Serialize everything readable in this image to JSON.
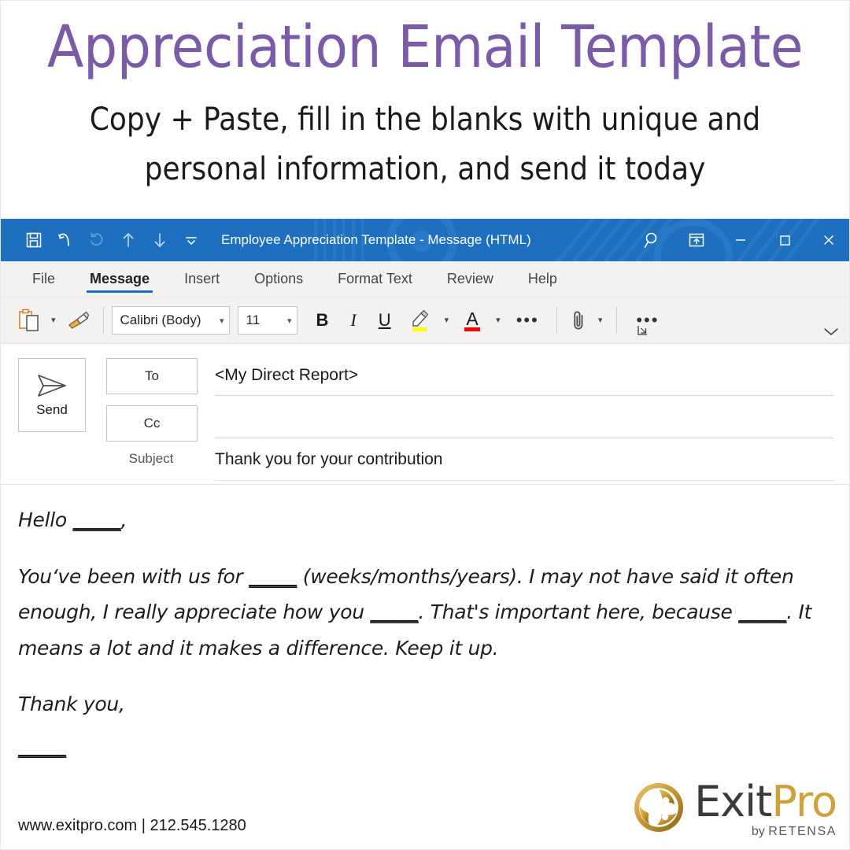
{
  "promo": {
    "title": "Appreciation Email Template",
    "subtitle": "Copy + Paste, fill in the blanks with unique and personal information, and send it today",
    "title_color": "#7B5BA8",
    "subtitle_color": "#1b1b1b"
  },
  "window": {
    "accent_color": "#1e6fc0",
    "title": "Employee Appreciation Template  -  Message (HTML)",
    "quick_access": [
      {
        "name": "save-icon",
        "label": "Save",
        "enabled": true
      },
      {
        "name": "undo-icon",
        "label": "Undo",
        "enabled": true
      },
      {
        "name": "redo-icon",
        "label": "Redo",
        "enabled": false
      },
      {
        "name": "previous-item-icon",
        "label": "Previous Item",
        "enabled": true
      },
      {
        "name": "next-item-icon",
        "label": "Next Item",
        "enabled": true
      },
      {
        "name": "customize-quick-access-icon",
        "label": "Customize Quick Access Toolbar",
        "enabled": true
      }
    ],
    "title_right": [
      {
        "name": "search-icon",
        "label": "Search"
      },
      {
        "name": "ribbon-display-options-icon",
        "label": "Ribbon Display Options"
      },
      {
        "name": "minimize-icon",
        "label": "Minimize"
      },
      {
        "name": "maximize-icon",
        "label": "Maximize"
      },
      {
        "name": "close-icon",
        "label": "Close"
      }
    ]
  },
  "ribbon": {
    "tabs": [
      {
        "label": "File",
        "active": false
      },
      {
        "label": "Message",
        "active": true
      },
      {
        "label": "Insert",
        "active": false
      },
      {
        "label": "Options",
        "active": false
      },
      {
        "label": "Format Text",
        "active": false
      },
      {
        "label": "Review",
        "active": false
      },
      {
        "label": "Help",
        "active": false
      }
    ]
  },
  "toolbar": {
    "paste_icon": "paste-icon",
    "format_painter_icon": "format-painter-icon",
    "font_name": "Calibri (Body)",
    "font_size": "11",
    "bold_label": "B",
    "italic_label": "I",
    "underline_label": "U",
    "highlight_icon": "text-highlight-color-icon",
    "highlight_color": "#ffff00",
    "font_color_label": "A",
    "font_color": "#ff0000",
    "more_formatting_label": "•••",
    "dialog_launcher_icon": "dialog-box-launcher-icon",
    "attach_icon": "attach-file-icon",
    "more_commands_label": "•••",
    "collapse_ribbon_icon": "collapse-ribbon-icon"
  },
  "compose": {
    "send_label": "Send",
    "send_icon": "send-paper-plane-icon",
    "to_label": "To",
    "cc_label": "Cc",
    "subject_label": "Subject",
    "to_value": "<My Direct Report>",
    "cc_value": "",
    "subject_value": "Thank you for your contribution"
  },
  "body": {
    "greeting_pre": "Hello ",
    "greeting_blank": "_____",
    "greeting_post": ",",
    "paragraph_1_a": "You‘ve been with us for ",
    "paragraph_1_blank_1": "_____",
    "paragraph_1_b": " (weeks/months/years). I may not have said it often enough, I really appreciate how you ",
    "paragraph_1_blank_2": "_____",
    "paragraph_1_c": ". That's important here, because ",
    "paragraph_1_blank_3": "_____",
    "paragraph_1_d": ". It means a lot and it makes a difference. Keep it up.",
    "closing": "Thank you,",
    "signature_blank": "_____"
  },
  "footer": {
    "contact": "www.exitpro.com | 212.545.1280",
    "logo": {
      "mark_icon": "exitpro-swirl-logo-icon",
      "word_1": "Exit",
      "word_2": "Pro",
      "tagline_by": "by ",
      "tagline_brand": "RETENSA",
      "gold": "#cfa13c",
      "dark": "#3b3b3b"
    }
  }
}
